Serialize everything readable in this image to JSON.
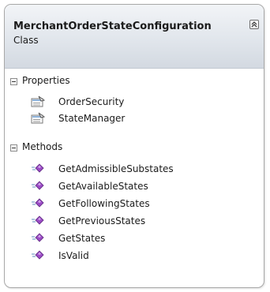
{
  "class_shape": {
    "title": "MerchantOrderStateConfiguration",
    "subtitle": "Class",
    "sections": [
      {
        "label": "Properties",
        "icon": "property-icon",
        "members": [
          "OrderSecurity",
          "StateManager"
        ]
      },
      {
        "label": "Methods",
        "icon": "method-icon",
        "members": [
          "GetAdmissibleSubstates",
          "GetAvailableStates",
          "GetFollowingStates",
          "GetPreviousStates",
          "GetStates",
          "IsValid"
        ]
      }
    ]
  },
  "colors": {
    "header_gradient_top": "#f2f4f7",
    "header_gradient_bottom": "#d3d9e1",
    "border": "#a8a8a8",
    "method_icon": "#9b4bc5"
  }
}
